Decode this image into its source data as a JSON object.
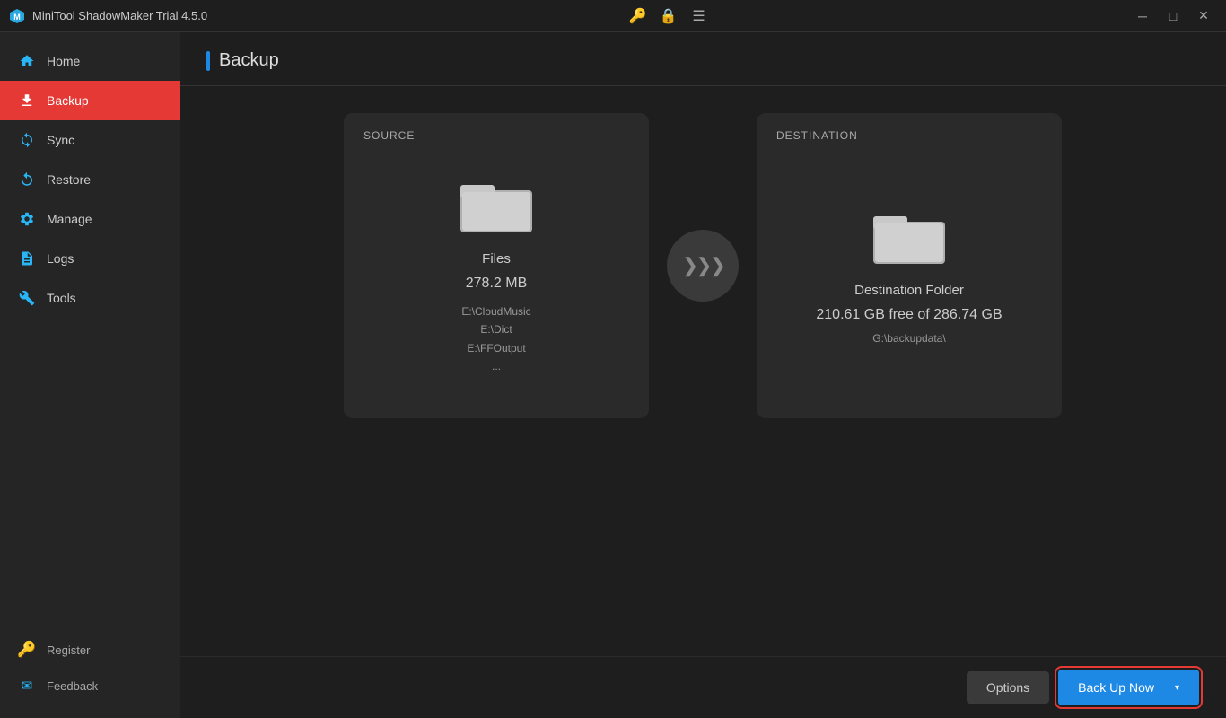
{
  "titlebar": {
    "title": "MiniTool ShadowMaker Trial 4.5.0",
    "icons": {
      "key": "🔑",
      "lock": "🔒",
      "menu": "☰"
    },
    "controls": {
      "minimize": "─",
      "maximize": "□",
      "close": "✕"
    }
  },
  "sidebar": {
    "nav_items": [
      {
        "id": "home",
        "label": "Home",
        "icon": "home",
        "active": false
      },
      {
        "id": "backup",
        "label": "Backup",
        "icon": "backup",
        "active": true
      },
      {
        "id": "sync",
        "label": "Sync",
        "icon": "sync",
        "active": false
      },
      {
        "id": "restore",
        "label": "Restore",
        "icon": "restore",
        "active": false
      },
      {
        "id": "manage",
        "label": "Manage",
        "icon": "manage",
        "active": false
      },
      {
        "id": "logs",
        "label": "Logs",
        "icon": "logs",
        "active": false
      },
      {
        "id": "tools",
        "label": "Tools",
        "icon": "tools",
        "active": false
      }
    ],
    "bottom_items": [
      {
        "id": "register",
        "label": "Register",
        "icon": "key"
      },
      {
        "id": "feedback",
        "label": "Feedback",
        "icon": "mail"
      }
    ]
  },
  "main": {
    "page_title": "Backup",
    "source_card": {
      "label": "SOURCE",
      "name": "Files",
      "size": "278.2 MB",
      "paths": [
        "E:\\CloudMusic",
        "E:\\Dict",
        "E:\\FFOutput",
        "..."
      ]
    },
    "destination_card": {
      "label": "DESTINATION",
      "name": "Destination Folder",
      "free": "210.61 GB free of 286.74 GB",
      "path": "G:\\backupdata\\"
    },
    "arrow_text": ">>>",
    "buttons": {
      "options": "Options",
      "backup_now": "Back Up Now"
    }
  }
}
